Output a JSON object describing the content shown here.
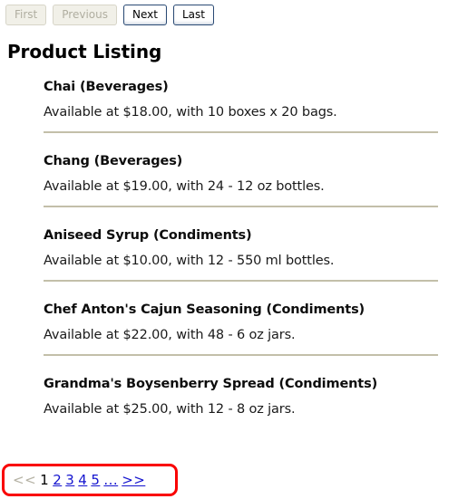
{
  "toolbar": {
    "buttons": [
      {
        "label": "First",
        "name": "first-button",
        "state": "disabled"
      },
      {
        "label": "Previous",
        "name": "previous-button",
        "state": "disabled"
      },
      {
        "label": "Next",
        "name": "next-button",
        "state": "enabled"
      },
      {
        "label": "Last",
        "name": "last-button",
        "state": "enabled"
      }
    ]
  },
  "heading": {
    "title": "Product Listing"
  },
  "products": [
    {
      "title": "Chai (Beverages)",
      "description": "Available at $18.00, with 10 boxes x 20 bags.",
      "name": "Chai",
      "category": "Beverages",
      "price": "$18.00",
      "packaging": "10 boxes x 20 bags",
      "separator": true
    },
    {
      "title": "Chang (Beverages)",
      "description": "Available at $19.00, with 24 - 12 oz bottles.",
      "name": "Chang",
      "category": "Beverages",
      "price": "$19.00",
      "packaging": "24 - 12 oz bottles",
      "separator": true
    },
    {
      "title": "Aniseed Syrup (Condiments)",
      "description": "Available at $10.00, with 12 - 550 ml bottles.",
      "name": "Aniseed Syrup",
      "category": "Condiments",
      "price": "$10.00",
      "packaging": "12 - 550 ml bottles",
      "separator": true
    },
    {
      "title": "Chef Anton's Cajun Seasoning (Condiments)",
      "description": "Available at $22.00, with 48 - 6 oz jars.",
      "name": "Chef Anton's Cajun Seasoning",
      "category": "Condiments",
      "price": "$22.00",
      "packaging": "48 - 6 oz jars",
      "separator": true
    },
    {
      "title": "Grandma's Boysenberry Spread (Condiments)",
      "description": "Available at $25.00, with 12 - 8 oz jars.",
      "name": "Grandma's Boysenberry Spread",
      "category": "Condiments",
      "price": "$25.00",
      "packaging": "12 - 8 oz jars",
      "separator": false
    }
  ],
  "pagination": {
    "items": [
      {
        "label": "<<",
        "state": "disabled",
        "name": "pagination-prev"
      },
      {
        "label": "1",
        "state": "current",
        "name": "pagination-page-1"
      },
      {
        "label": "2",
        "state": "link",
        "name": "pagination-page-2"
      },
      {
        "label": "3",
        "state": "link",
        "name": "pagination-page-3"
      },
      {
        "label": "4",
        "state": "link",
        "name": "pagination-page-4"
      },
      {
        "label": "5",
        "state": "link",
        "name": "pagination-page-5"
      },
      {
        "label": "...",
        "state": "link",
        "name": "pagination-ellipsis"
      },
      {
        "label": ">>",
        "state": "link",
        "name": "pagination-next"
      }
    ],
    "highlight_color": "#f90000",
    "link_color": "#1414cf",
    "disabled_color": "#b5b2a4"
  }
}
